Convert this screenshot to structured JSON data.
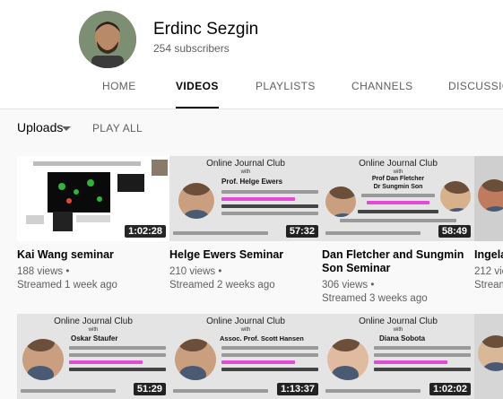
{
  "channel": {
    "name": "Erdinc Sezgin",
    "subscribers": "254 subscribers"
  },
  "tabs": [
    {
      "label": "HOME"
    },
    {
      "label": "VIDEOS"
    },
    {
      "label": "PLAYLISTS"
    },
    {
      "label": "CHANNELS"
    },
    {
      "label": "DISCUSSION"
    }
  ],
  "active_tab": "VIDEOS",
  "section": {
    "uploads_label": "Uploads",
    "play_all_label": "PLAY ALL"
  },
  "poster": {
    "heading": "Online Journal Club",
    "with": "with"
  },
  "videos": [
    {
      "title": "Kai Wang seminar",
      "views": "188 views",
      "streamed": "Streamed 1 week ago",
      "duration": "1:02:28"
    },
    {
      "title": "Helge Ewers Seminar",
      "views": "210 views",
      "streamed": "Streamed 2 weeks ago",
      "duration": "57:32",
      "speaker": "Prof. Helge Ewers"
    },
    {
      "title": "Dan Fletcher and Sungmin Son Seminar",
      "views": "306 views",
      "streamed": "Streamed 3 weeks ago",
      "duration": "58:49",
      "speaker": "Prof Dan Fletcher",
      "speaker2": "Dr Sungmin Son"
    },
    {
      "title": "Ingela",
      "views": "212 vie",
      "streamed": "Stream"
    },
    {
      "duration": "51:29",
      "speaker": "Oskar Staufer"
    },
    {
      "duration": "1:13:37",
      "speaker": "Assoc. Prof. Scott Hansen"
    },
    {
      "duration": "1:02:02",
      "speaker": "Diana Sobota"
    }
  ],
  "colors": {
    "active_tab_underline": "#030303",
    "secondary_text": "#606060",
    "duration_badge": "#000000",
    "poster_accent": "#e24bd4"
  }
}
